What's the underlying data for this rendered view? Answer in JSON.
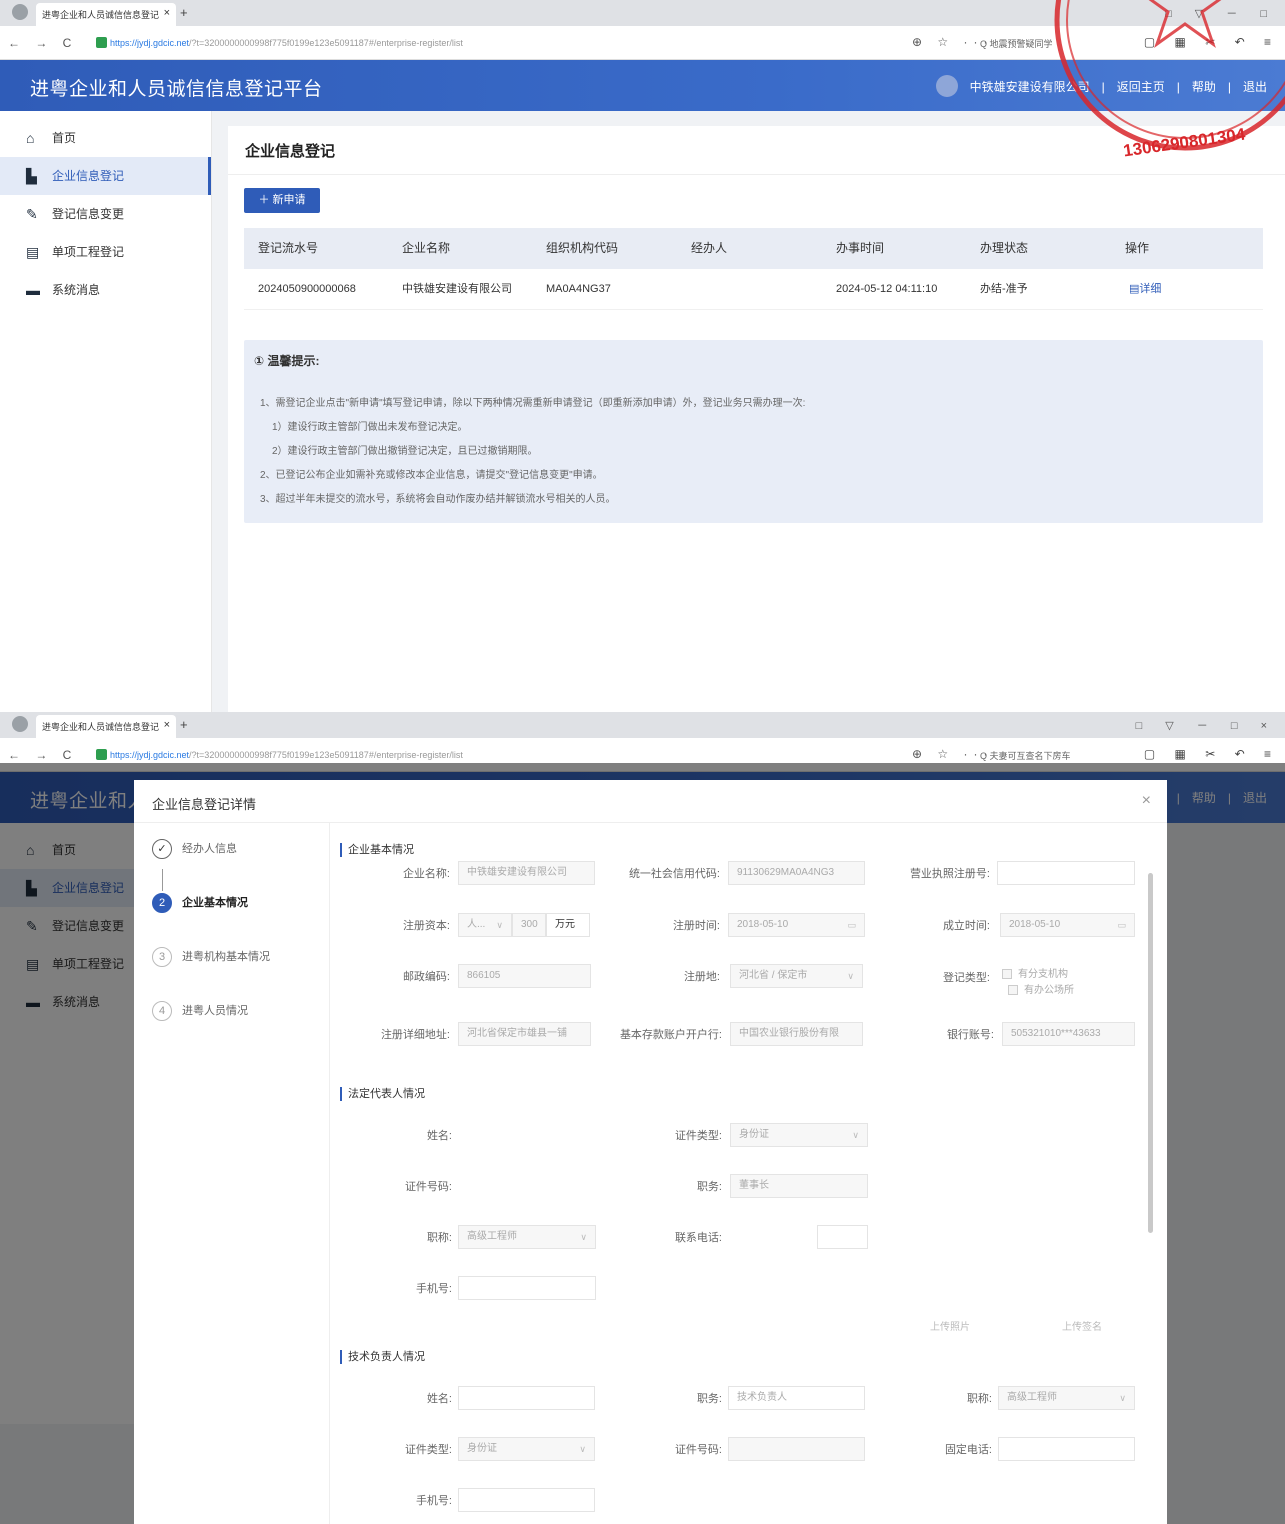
{
  "browser1": {
    "tab_title": "进粤企业和人员诚信信息登记",
    "url_host": "https://jydj.gdcic.net",
    "url_path": "/?t=3200000000998f775f0199e123e5091187#/enterprise-register/list",
    "search_text": "地震预警疑同学",
    "window_controls": "□ ▽ － □"
  },
  "browser2": {
    "tab_title": "进粤企业和人员诚信信息登记",
    "url_host": "https://jydj.gdcic.net",
    "url_path": "/?t=3200000000998f775f0199e123e5091187#/enterprise-register/list",
    "search_text": "夫妻可互查名下房车",
    "window_controls": "□ ▽ － □ ×"
  },
  "header": {
    "title": "进粤企业和人员诚信信息登记平台",
    "company": "中铁雄安建设有限公司",
    "home": "返回主页",
    "help": "帮助",
    "logout": "退出",
    "sep": "|"
  },
  "sidebar": {
    "items": [
      {
        "label": "首页",
        "icon": "home-icon"
      },
      {
        "label": "企业信息登记",
        "icon": "register-icon"
      },
      {
        "label": "登记信息变更",
        "icon": "edit-icon"
      },
      {
        "label": "单项工程登记",
        "icon": "clipboard-icon"
      },
      {
        "label": "系统消息",
        "icon": "message-icon"
      }
    ]
  },
  "page": {
    "title": "企业信息登记",
    "new_button": "＋ 新申请",
    "columns": [
      "登记流水号",
      "企业名称",
      "组织机构代码",
      "经办人",
      "办事时间",
      "办理状态",
      "操作"
    ],
    "rows": [
      [
        "2024050900000068",
        "中铁雄安建设有限公司",
        "MA0A4NG37",
        "",
        "2024-05-12 04:11:10",
        "办结-准予",
        "详细"
      ]
    ],
    "tip": {
      "heading": "① 温馨提示:",
      "lines": [
        "1、需登记企业点击\"新申请\"填写登记申请，除以下两种情况需重新申请登记（即重新添加申请）外，登记业务只需办理一次:",
        "1）建设行政主管部门做出未发布登记决定。",
        "2）建设行政主管部门做出撤销登记决定，且已过撤销期限。",
        "2、已登记公布企业如需补充或修改本企业信息，请提交\"登记信息变更\"申请。",
        "3、超过半年未提交的流水号，系统将会自动作废办结并解锁流水号相关的人员。"
      ]
    },
    "stamp_number": "1306290801304"
  },
  "modal": {
    "title": "企业信息登记详情",
    "close": "×",
    "steps": [
      {
        "num": "✓",
        "label": "经办人信息"
      },
      {
        "num": "2",
        "label": "企业基本情况"
      },
      {
        "num": "3",
        "label": "进粤机构基本情况"
      },
      {
        "num": "4",
        "label": "进粤人员情况"
      }
    ],
    "sec_basic": "企业基本情况",
    "company_name_label": "企业名称:",
    "company_name": "中铁雄安建设有限公司",
    "credit_code_label": "统一社会信用代码:",
    "credit_code": "91130629MA0A4NG3",
    "license_label": "营业执照注册号:",
    "capital_label": "注册资本:",
    "capital_currency": "人...",
    "capital_value": "300",
    "capital_unit": "万元",
    "reg_time_label": "注册时间:",
    "reg_time": "2018-05-10",
    "est_time_label": "成立时间:",
    "est_time": "2018-05-10",
    "postcode_label": "邮政编码:",
    "postcode": "866105",
    "reg_place_label": "注册地:",
    "reg_place": "河北省 / 保定市",
    "reg_type_label": "登记类型:",
    "reg_type_opt1": "有分支机构",
    "reg_type_opt2": "有办公场所",
    "address_label": "注册详细地址:",
    "address": "河北省保定市雄县一铺",
    "bank_label": "基本存款账户开户行:",
    "bank": "中国农业银行股份有限",
    "account_label": "银行账号:",
    "account": "505321010***43633",
    "sec_legal": "法定代表人情况",
    "name_label": "姓名:",
    "id_type_label": "证件类型:",
    "id_type": "身份证",
    "id_no_label": "证件号码:",
    "post_label": "职务:",
    "legal_post": "董事长",
    "title_label": "职称:",
    "legal_title": "高级工程师",
    "phone_label": "联系电话:",
    "mobile_label": "手机号:",
    "upload_photo": "上传照片",
    "upload_sign": "上传签名",
    "sec_tech": "技术负责人情况",
    "tech_post": "技术负责人",
    "tech_title": "高级工程师",
    "tech_id_type": "身份证",
    "fixed_phone_label": "固定电话:"
  }
}
